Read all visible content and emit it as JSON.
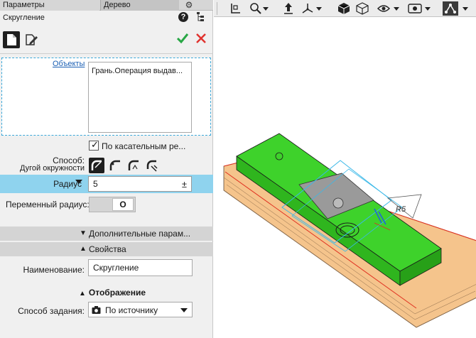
{
  "panel": {
    "tab_params": "Параметры",
    "tab_tree": "Дерево",
    "title": "Скругление"
  },
  "objects": {
    "link_label": "Объекты",
    "items": [
      "Грань.Операция выдав..."
    ]
  },
  "tangent_checkbox": {
    "label": "По касательным ре...",
    "checked": true
  },
  "method": {
    "label_line1": "Способ:",
    "label_line2": "Дугой окружности"
  },
  "radius": {
    "label": "Радиус",
    "value": "5",
    "pm": "±"
  },
  "variable_radius": {
    "label": "Переменный радиус:",
    "toggle_text": "O"
  },
  "sections": {
    "additional": "Дополнительные парам...",
    "properties": "Свойства"
  },
  "name_field": {
    "label": "Наименование:",
    "value": "Скругление"
  },
  "display": {
    "header": "Отображение"
  },
  "spec": {
    "label": "Способ задания:",
    "value": "По источнику"
  },
  "colors": {
    "accent_row": "#8fd3ee",
    "part_green": "#3ed22b",
    "base_orange": "#f5c48c",
    "ok_green": "#28a745",
    "cancel_red": "#e0332f"
  }
}
